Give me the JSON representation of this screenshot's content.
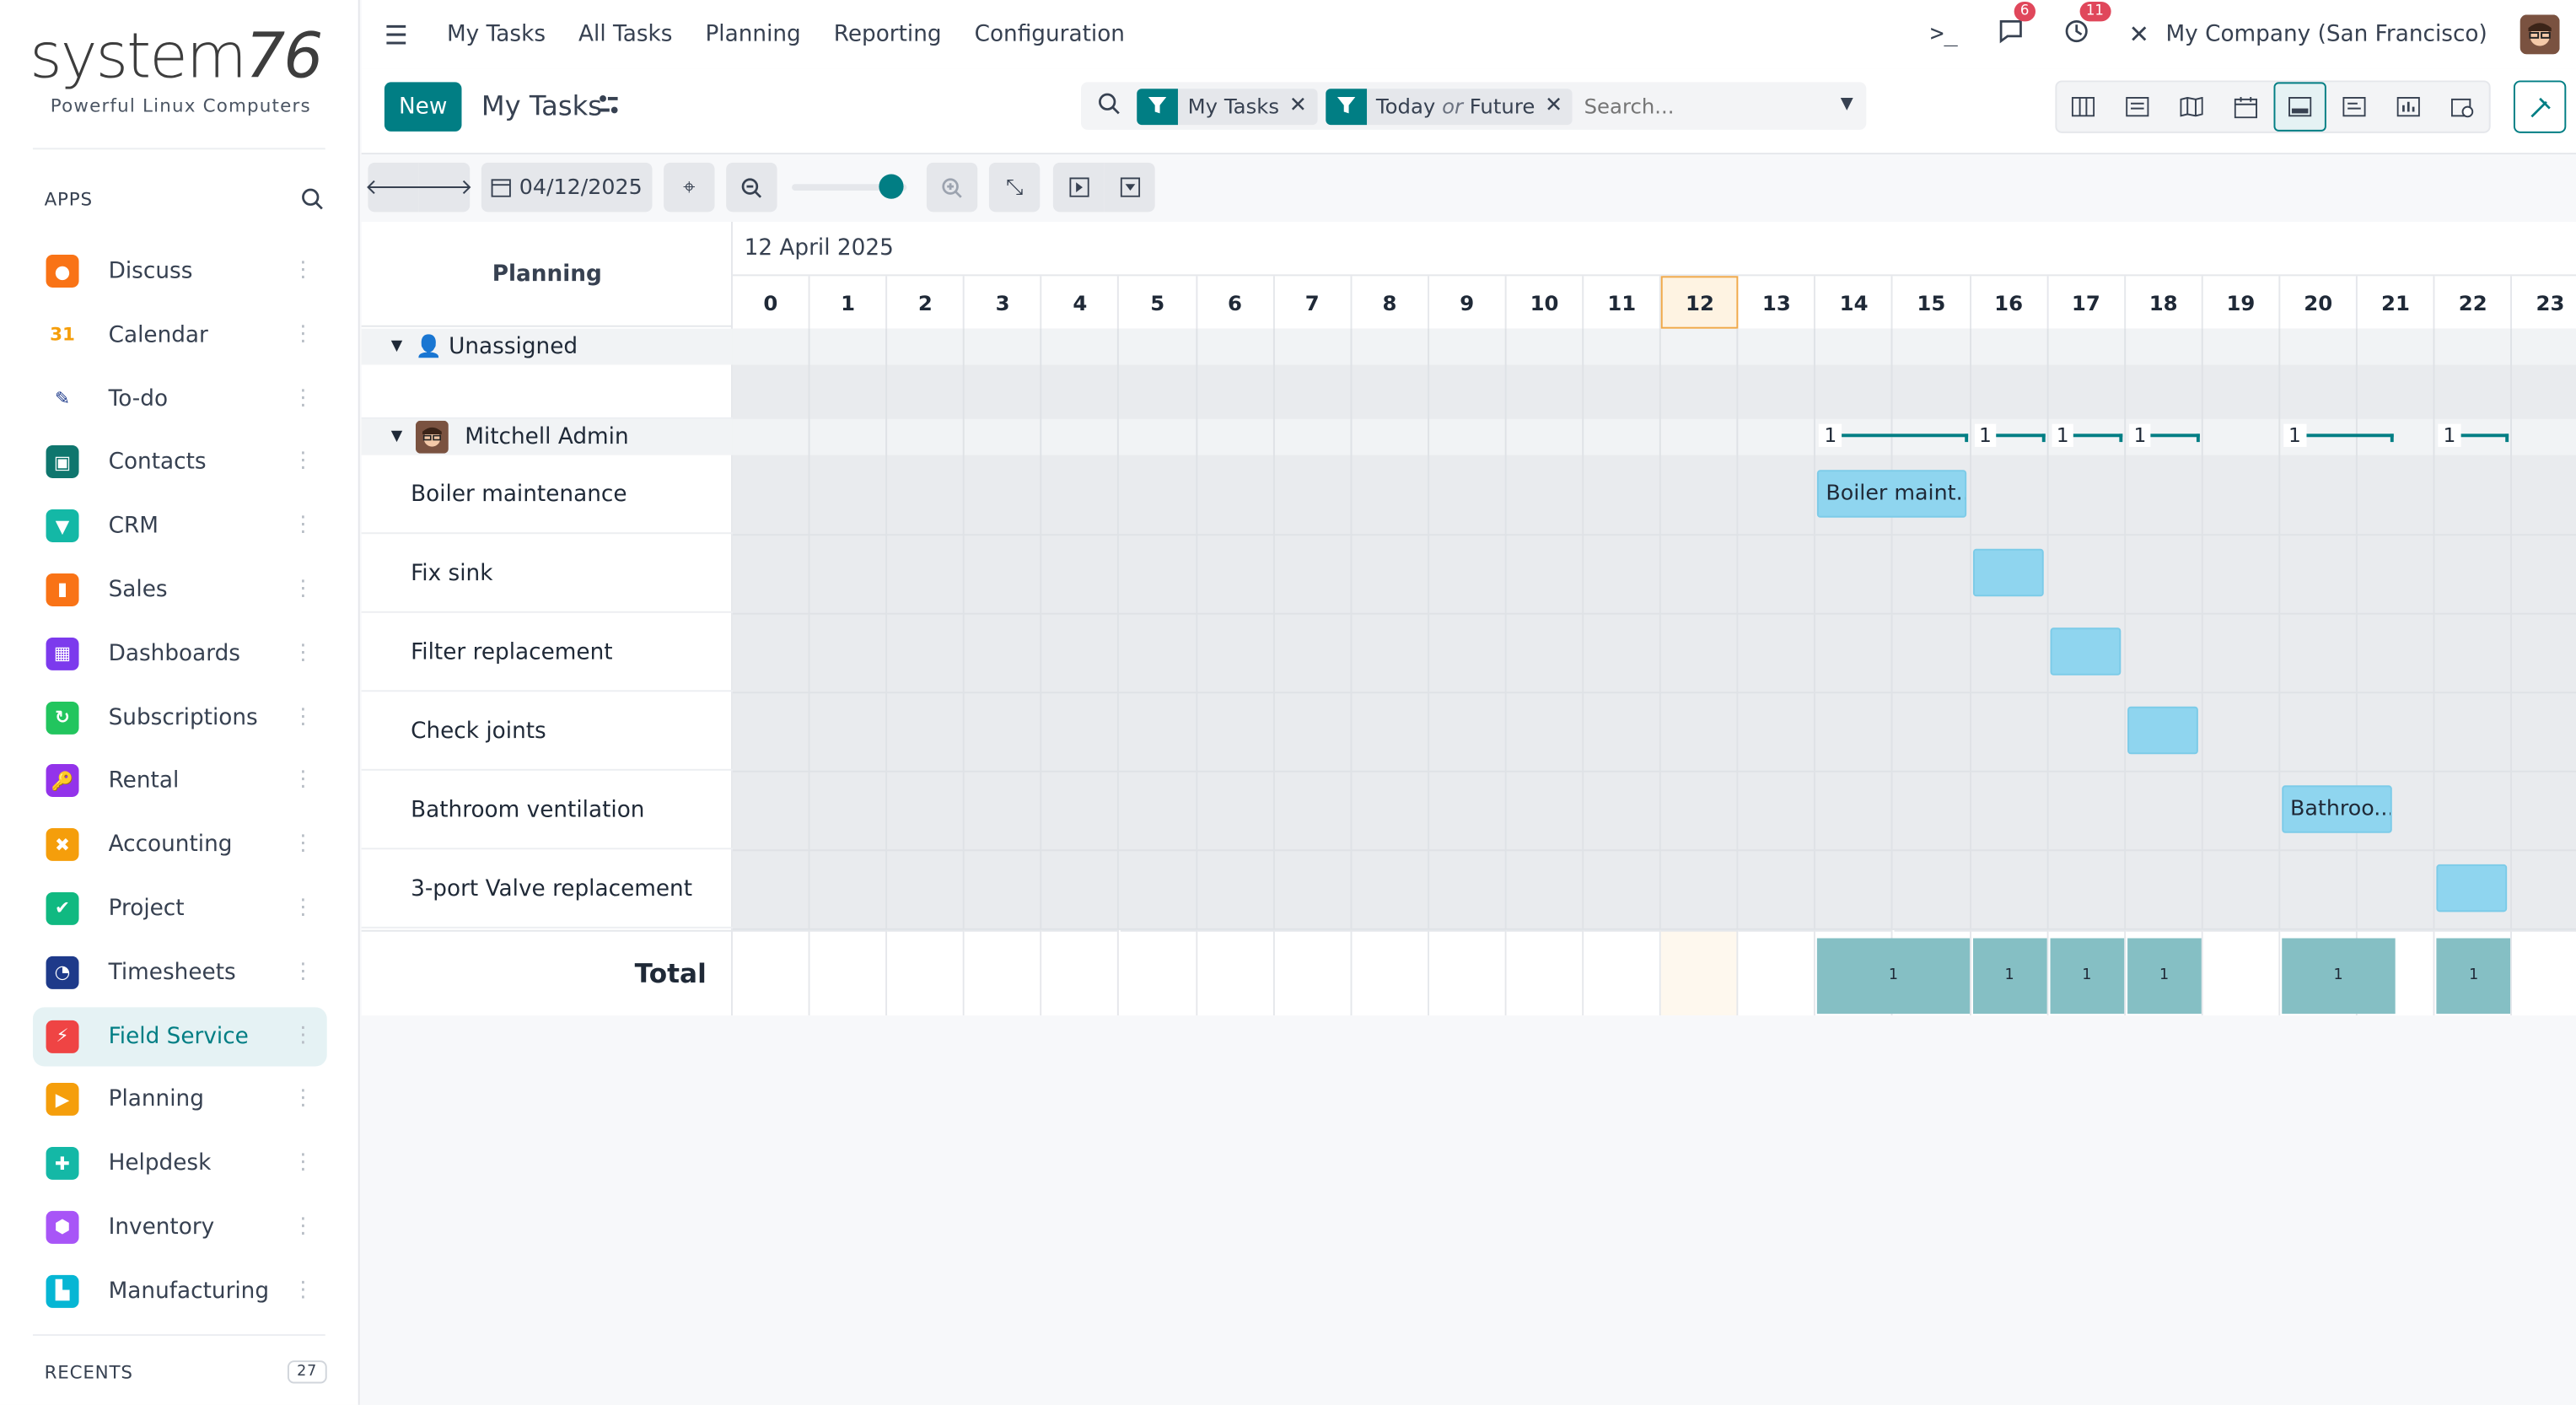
{
  "brand": {
    "name_text": "system",
    "name_nums": "76",
    "tagline": "Powerful Linux Computers"
  },
  "sidebar": {
    "apps_label": "APPS",
    "recents_label": "RECENTS",
    "recents_count": "27",
    "items": [
      {
        "label": "Discuss",
        "icon": "discuss-icon",
        "color": "#f97316"
      },
      {
        "label": "Calendar",
        "icon": "calendar-icon",
        "color": "#ffffff"
      },
      {
        "label": "To-do",
        "icon": "todo-icon",
        "color": "#ffffff"
      },
      {
        "label": "Contacts",
        "icon": "contacts-icon",
        "color": "#0f766e"
      },
      {
        "label": "CRM",
        "icon": "crm-icon",
        "color": "#14b8a6"
      },
      {
        "label": "Sales",
        "icon": "sales-icon",
        "color": "#f97316"
      },
      {
        "label": "Dashboards",
        "icon": "dashboards-icon",
        "color": "#7c3aed"
      },
      {
        "label": "Subscriptions",
        "icon": "subscriptions-icon",
        "color": "#22c55e"
      },
      {
        "label": "Rental",
        "icon": "rental-icon",
        "color": "#9333ea"
      },
      {
        "label": "Accounting",
        "icon": "accounting-icon",
        "color": "#f59e0b"
      },
      {
        "label": "Project",
        "icon": "project-icon",
        "color": "#10b981"
      },
      {
        "label": "Timesheets",
        "icon": "timesheets-icon",
        "color": "#1e3a8a"
      },
      {
        "label": "Field Service",
        "icon": "field-service-icon",
        "color": "#ef4444",
        "active": true
      },
      {
        "label": "Planning",
        "icon": "planning-icon",
        "color": "#f59e0b"
      },
      {
        "label": "Helpdesk",
        "icon": "helpdesk-icon",
        "color": "#14b8a6"
      },
      {
        "label": "Inventory",
        "icon": "inventory-icon",
        "color": "#a855f7"
      },
      {
        "label": "Manufacturing",
        "icon": "manufacturing-icon",
        "color": "#06b6d4"
      }
    ]
  },
  "topnav": {
    "menu": [
      "My Tasks",
      "All Tasks",
      "Planning",
      "Reporting",
      "Configuration"
    ],
    "messages_badge": "6",
    "activities_badge": "11",
    "company": "My Company (San Francisco)"
  },
  "control": {
    "new_label": "New",
    "title": "My Tasks",
    "facet1": "My Tasks",
    "facet2_a": "Today",
    "facet2_or": "or",
    "facet2_b": "Future",
    "search_placeholder": "Search..."
  },
  "toolbar": {
    "date": "04/12/2025",
    "zoom_level": 0.85
  },
  "gantt": {
    "title": "Planning",
    "month": "12 April 2025",
    "days": [
      "0",
      "1",
      "2",
      "3",
      "4",
      "5",
      "6",
      "7",
      "8",
      "9",
      "10",
      "11",
      "12",
      "13",
      "14",
      "15",
      "16",
      "17",
      "18",
      "19",
      "20",
      "21",
      "22",
      "23"
    ],
    "today_index": 12,
    "group_unassigned": "Unassigned",
    "group_mitchell": "Mitchell Admin",
    "rows": [
      "Boiler maintenance",
      "Fix sink",
      "Filter replacement",
      "Check joints",
      "Bathroom ventilation",
      "3-port Valve replacement"
    ],
    "pills": [
      {
        "row": 0,
        "start": 14,
        "end": 16,
        "label": "Boiler maint..."
      },
      {
        "row": 1,
        "start": 16,
        "end": 17,
        "label": ""
      },
      {
        "row": 2,
        "start": 17,
        "end": 18,
        "label": ""
      },
      {
        "row": 3,
        "start": 18,
        "end": 19,
        "label": ""
      },
      {
        "row": 4,
        "start": 20,
        "end": 21.5,
        "label": "Bathroo..."
      },
      {
        "row": 5,
        "start": 22,
        "end": 23,
        "label": ""
      }
    ],
    "aggregates": [
      {
        "start": 14,
        "end": 16,
        "value": "1"
      },
      {
        "start": 16,
        "end": 17,
        "value": "1"
      },
      {
        "start": 17,
        "end": 18,
        "value": "1"
      },
      {
        "start": 18,
        "end": 19,
        "value": "1"
      },
      {
        "start": 20,
        "end": 21.5,
        "value": "1"
      },
      {
        "start": 22,
        "end": 23,
        "value": "1"
      }
    ],
    "total_label": "Total",
    "totals": [
      {
        "start": 14,
        "end": 16,
        "value": "1"
      },
      {
        "start": 16,
        "end": 17,
        "value": "1"
      },
      {
        "start": 17,
        "end": 18,
        "value": "1"
      },
      {
        "start": 18,
        "end": 19,
        "value": "1"
      },
      {
        "start": 20,
        "end": 21.5,
        "value": "1"
      },
      {
        "start": 22,
        "end": 23,
        "value": "1"
      }
    ]
  }
}
